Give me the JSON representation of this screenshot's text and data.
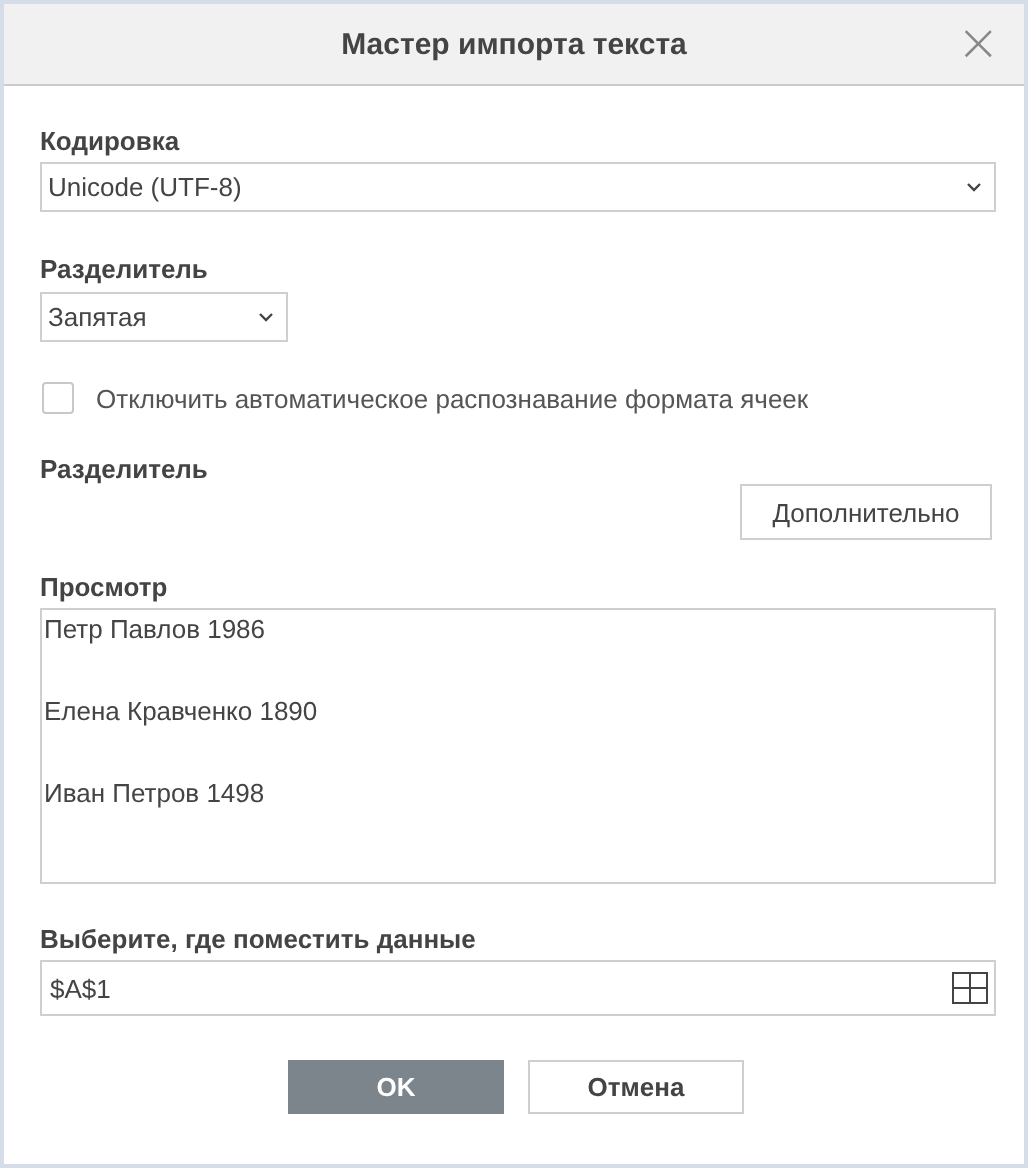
{
  "window": {
    "title": "Мастер импорта текста",
    "close": "×"
  },
  "encoding": {
    "label": "Кодировка",
    "value": "Unicode (UTF-8)"
  },
  "delimiter": {
    "label": "Разделитель",
    "value": "Запятая"
  },
  "auto_format": {
    "label": "Отключить автоматическое распознавание формата ячеек",
    "checked": false
  },
  "separator": {
    "label": "Разделитель",
    "button": "Дополнительно"
  },
  "preview": {
    "label": "Просмотр",
    "lines": [
      "Петр Павлов 1986",
      "Елена Кравченко 1890",
      "Иван Петров 1498"
    ]
  },
  "destination": {
    "label": "Выберите, где поместить данные",
    "value": "$A$1"
  },
  "buttons": [
    {
      "label": "OK",
      "kind": "primary"
    },
    {
      "label": "Отмена",
      "kind": "secondary"
    }
  ]
}
